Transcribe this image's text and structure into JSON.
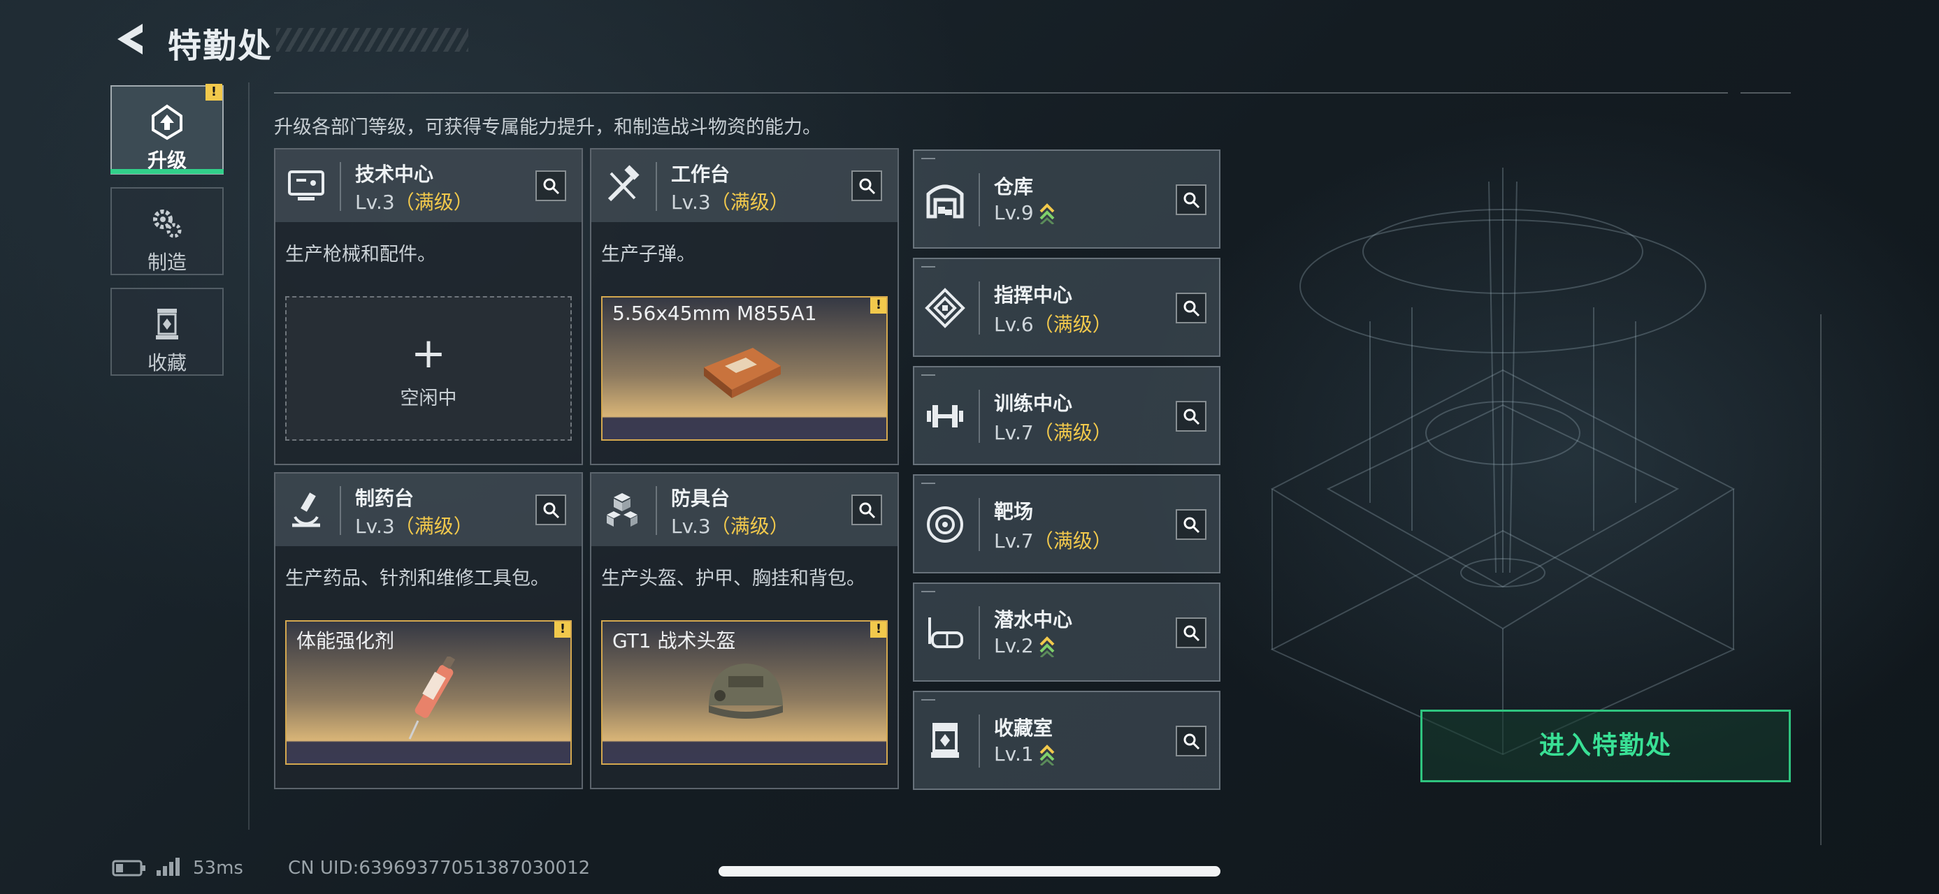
{
  "header": {
    "title": "特勤处"
  },
  "nav": [
    {
      "label": "升级",
      "icon": "upgrade-icon",
      "badge": "!"
    },
    {
      "label": "制造",
      "icon": "gears-icon"
    },
    {
      "label": "收藏",
      "icon": "collection-icon"
    }
  ],
  "description": "升级各部门等级，可获得专属能力提升，和制造战斗物资的能力。",
  "workshops": [
    {
      "name": "技术中心",
      "level": "Lv.3",
      "status": "（满级）",
      "text": "生产枪械和配件。",
      "slot": {
        "state": "空闲中",
        "plus": "+"
      },
      "icon": "monitor-icon"
    },
    {
      "name": "工作台",
      "level": "Lv.3",
      "status": "（满级）",
      "text": "生产子弹。",
      "slot": {
        "item": "5.56x45mm M855A1",
        "badge": "!"
      },
      "icon": "tools-icon"
    },
    {
      "name": "制药台",
      "level": "Lv.3",
      "status": "（满级）",
      "text": "生产药品、针剂和维修工具包。",
      "slot": {
        "item": "体能强化剂",
        "badge": "!"
      },
      "icon": "microscope-icon"
    },
    {
      "name": "防具台",
      "level": "Lv.3",
      "status": "（满级）",
      "text": "生产头盔、护甲、胸挂和背包。",
      "slot": {
        "item": "GT1 战术头盔",
        "badge": "!"
      },
      "icon": "boxes-icon"
    }
  ],
  "facilities": [
    {
      "name": "仓库",
      "level": "Lv.9",
      "status": "",
      "upgradable": true,
      "icon": "warehouse-icon"
    },
    {
      "name": "指挥中心",
      "level": "Lv.6",
      "status": "（满级）",
      "icon": "command-icon"
    },
    {
      "name": "训练中心",
      "level": "Lv.7",
      "status": "（满级）",
      "icon": "dumbbell-icon"
    },
    {
      "name": "靶场",
      "level": "Lv.7",
      "status": "（满级）",
      "icon": "target-icon"
    },
    {
      "name": "潜水中心",
      "level": "Lv.2",
      "status": "",
      "upgradable": true,
      "icon": "diving-mask-icon"
    },
    {
      "name": "收藏室",
      "level": "Lv.1",
      "status": "",
      "upgradable": true,
      "icon": "display-case-icon"
    }
  ],
  "enter_button": "进入特勤处",
  "status_bar": {
    "ping": "53ms",
    "uid": "CN UID:63969377051387030012"
  },
  "colors": {
    "accent": "#31d08a",
    "gold": "#f2c94c"
  }
}
